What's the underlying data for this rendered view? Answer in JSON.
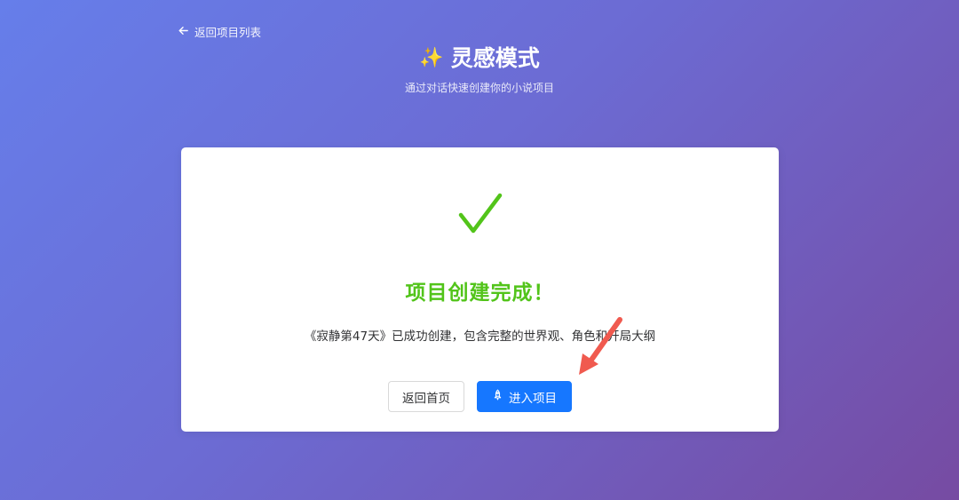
{
  "nav": {
    "back_label": "返回项目列表"
  },
  "header": {
    "sparkle": "✨",
    "title": "灵感模式",
    "subtitle": "通过对话快速创建你的小说项目"
  },
  "result": {
    "title": "项目创建完成！",
    "description": "《寂静第47天》已成功创建，包含完整的世界观、角色和开局大纲"
  },
  "actions": {
    "home_label": "返回首页",
    "enter_label": "进入项目"
  },
  "colors": {
    "gradient_start": "#667eea",
    "gradient_end": "#764ba2",
    "success": "#52c41a",
    "primary": "#1677ff",
    "annotation": "#f05a4f"
  }
}
